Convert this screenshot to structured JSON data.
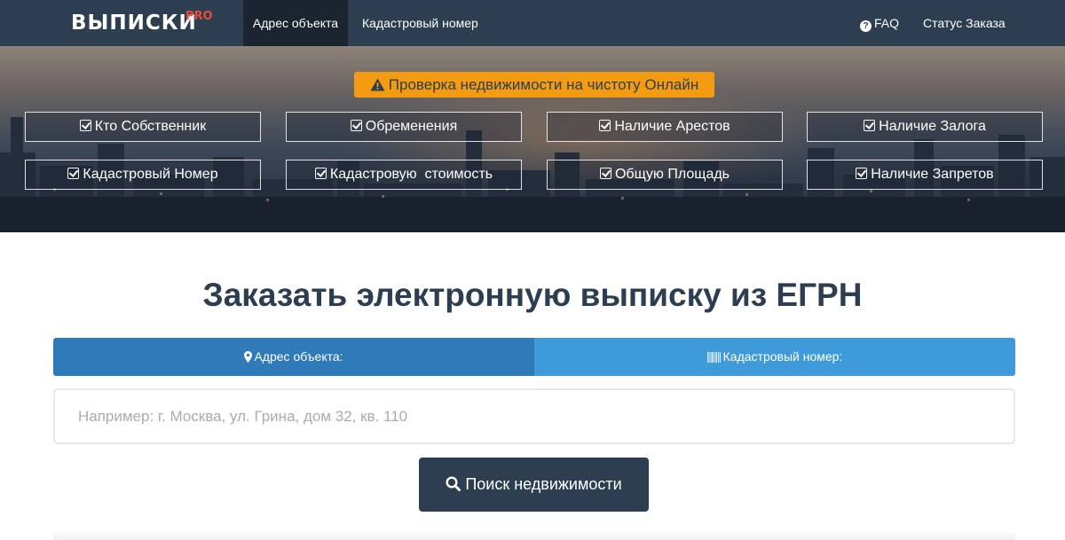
{
  "navbar": {
    "brand": "ВЫПИСКИ",
    "brand_suffix": "PRO",
    "items": [
      {
        "label": "Адрес объекта",
        "active": true
      },
      {
        "label": "Кадастровый номер",
        "active": false
      }
    ],
    "right_items": [
      {
        "label": "FAQ",
        "icon": "question-circle-icon"
      },
      {
        "label": "Статус Заказа"
      }
    ]
  },
  "hero": {
    "badge": "Проверка недвижимости на чистоту Онлайн",
    "badge_icon": "warning-icon",
    "features": [
      "Кто Собственник",
      "Обременения",
      "Наличие Арестов",
      "Наличие Залога",
      "Кадастровый Номер",
      "Кадастровую  стоимость",
      "Общую Площадь",
      "Наличие Запретов"
    ]
  },
  "main": {
    "title": "Заказать электронную выписку из ЕГРН",
    "tabs": [
      {
        "label": "Адрес объекта:",
        "icon": "map-marker-icon",
        "active": true
      },
      {
        "label": "Кадастровый номер:",
        "icon": "barcode-icon",
        "active": false
      }
    ],
    "search": {
      "value": "",
      "placeholder": "Например: г. Москва, ул. Грина, дом 32, кв. 110"
    },
    "search_button": "Поиск недвижимости"
  },
  "colors": {
    "navbar": "#2c3e50",
    "badge": "#f39c12",
    "tab_active": "#2f7ab9",
    "tab_inactive": "#3f9ad9",
    "brand_accent": "#e74c3c"
  }
}
